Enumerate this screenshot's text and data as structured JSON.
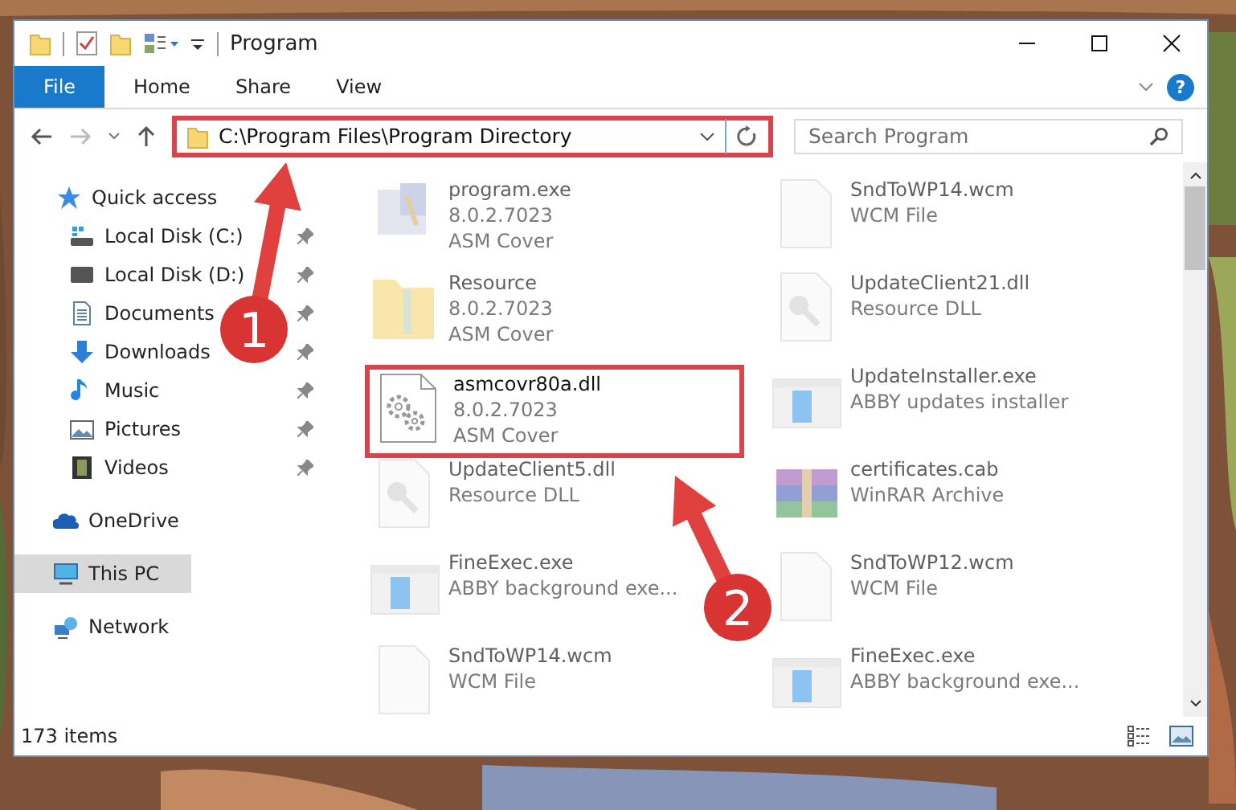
{
  "window": {
    "title": "Program"
  },
  "ribbon": {
    "tabs": [
      {
        "label": "File",
        "kind": "file"
      },
      {
        "label": "Home",
        "kind": "tab"
      },
      {
        "label": "Share",
        "kind": "tab"
      },
      {
        "label": "View",
        "kind": "tab"
      }
    ],
    "help": "?"
  },
  "address_bar": {
    "path": "C:\\Program Files\\Program Directory",
    "highlighted": true
  },
  "search": {
    "placeholder": "Search Program"
  },
  "nav": [
    {
      "label": "Quick access",
      "kind": "star",
      "selected": false,
      "pinned": false,
      "children": [
        {
          "label": "Local Disk (C:)",
          "kind": "disk-c",
          "selected": false,
          "pinned": true
        },
        {
          "label": "Local Disk (D:)",
          "kind": "disk",
          "selected": false,
          "pinned": true
        },
        {
          "label": "Documents",
          "kind": "docs",
          "selected": false,
          "pinned": true
        },
        {
          "label": "Downloads",
          "kind": "download",
          "selected": false,
          "pinned": true
        },
        {
          "label": "Music",
          "kind": "music",
          "selected": false,
          "pinned": true
        },
        {
          "label": "Pictures",
          "kind": "pictures",
          "selected": false,
          "pinned": true
        },
        {
          "label": "Videos",
          "kind": "videos",
          "selected": false,
          "pinned": true
        }
      ]
    },
    {
      "label": "OneDrive",
      "kind": "cloud",
      "selected": false,
      "pinned": false
    },
    {
      "label": "This PC",
      "kind": "pc",
      "selected": true,
      "pinned": false
    },
    {
      "label": "Network",
      "kind": "network",
      "selected": false,
      "pinned": false
    }
  ],
  "files": [
    {
      "name": "program.exe",
      "details": [
        "8.0.2.7023",
        "ASM Cover"
      ],
      "kind": "program",
      "faded": true,
      "highlighted": false
    },
    {
      "name": "SndToWP14.wcm",
      "details": [
        "WCM File"
      ],
      "kind": "blank",
      "faded": true,
      "highlighted": false
    },
    {
      "name": "Resource",
      "details": [
        "8.0.2.7023",
        "ASM Cover"
      ],
      "kind": "folder",
      "faded": true,
      "highlighted": false
    },
    {
      "name": "UpdateClient21.dll",
      "details": [
        "Resource DLL"
      ],
      "kind": "dll",
      "faded": true,
      "highlighted": false
    },
    {
      "name": "asmcovr80a.dll",
      "details": [
        "8.0.2.7023",
        "ASM Cover"
      ],
      "kind": "gears",
      "faded": false,
      "highlighted": true
    },
    {
      "name": "UpdateInstaller.exe",
      "details": [
        "ABBY updates installer"
      ],
      "kind": "window",
      "faded": true,
      "highlighted": false
    },
    {
      "name": "UpdateClient5.dll",
      "details": [
        "Resource DLL"
      ],
      "kind": "dll",
      "faded": true,
      "highlighted": false
    },
    {
      "name": "certificates.cab",
      "details": [
        "WinRAR Archive"
      ],
      "kind": "archive",
      "faded": true,
      "highlighted": false
    },
    {
      "name": "FineExec.exe",
      "details": [
        "ABBY background exe..."
      ],
      "kind": "window",
      "faded": true,
      "highlighted": false
    },
    {
      "name": "SndToWP12.wcm",
      "details": [
        "WCM File"
      ],
      "kind": "blank",
      "faded": true,
      "highlighted": false
    },
    {
      "name": "SndToWP14.wcm",
      "details": [
        "WCM File"
      ],
      "kind": "blank",
      "faded": true,
      "highlighted": false
    },
    {
      "name": "FineExec.exe",
      "details": [
        "ABBY background exe..."
      ],
      "kind": "window",
      "faded": true,
      "highlighted": false
    }
  ],
  "status_bar": {
    "item_count": "173 items"
  },
  "annotations": [
    {
      "label": "1"
    },
    {
      "label": "2"
    }
  ]
}
